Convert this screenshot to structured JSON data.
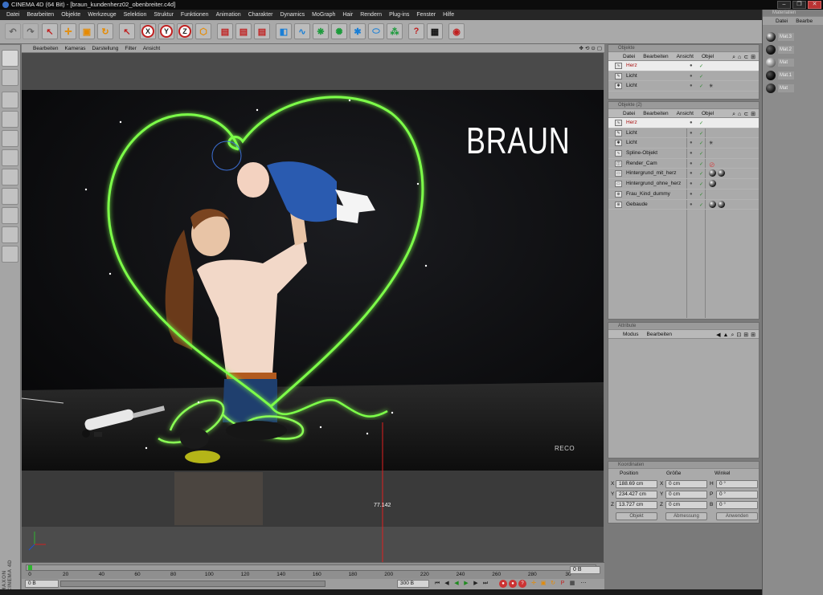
{
  "window": {
    "title": "CINEMA 4D (64 Bit) - [braun_kundenherz02_obenbreiter.c4d]"
  },
  "menubar": [
    "Datei",
    "Bearbeiten",
    "Objekte",
    "Werkzeuge",
    "Selektion",
    "Struktur",
    "Funktionen",
    "Animation",
    "Charakter",
    "Dynamics",
    "MoGraph",
    "Hair",
    "Rendern",
    "Plug-ins",
    "Fenster",
    "Hilfe"
  ],
  "viewport": {
    "menu": [
      "Bearbeiten",
      "Kameras",
      "Darstellung",
      "Filter",
      "Ansicht"
    ],
    "nav_icons": [
      "move-view-icon",
      "camera-view-icon",
      "rotate-view-icon",
      "maximize-view-icon"
    ],
    "ruler_value": "77.142",
    "logo_text": "BRAUN",
    "watermark": "RECO"
  },
  "objects_panel_1": {
    "header": "Objekte",
    "menu": [
      "Datei",
      "Bearbeiten",
      "Ansicht",
      "Objel"
    ],
    "rows": [
      {
        "name": "Herz",
        "selected": true
      },
      {
        "name": "Licht",
        "selected": false
      },
      {
        "name": "Licht",
        "selected": false
      }
    ]
  },
  "objects_panel_2": {
    "header": "Objekte (2)",
    "menu": [
      "Datei",
      "Bearbeiten",
      "Ansicht",
      "Objel"
    ],
    "rows": [
      {
        "name": "Herz",
        "selected": true
      },
      {
        "name": "Licht",
        "selected": false
      },
      {
        "name": "Licht",
        "selected": false
      },
      {
        "name": "Spline-Objekt",
        "selected": false
      },
      {
        "name": "Render_Cam",
        "selected": false
      },
      {
        "name": "Hintergrund_mit_herz",
        "selected": false
      },
      {
        "name": "Hintergrund_ohne_herz",
        "selected": false
      },
      {
        "name": "Frau_Kind_dummy",
        "selected": false
      },
      {
        "name": "Gebaude",
        "selected": false
      }
    ]
  },
  "attributes_panel": {
    "header": "Attribute",
    "menu": [
      "Modus",
      "Bearbeiten"
    ]
  },
  "coordinates_panel": {
    "header": "Koordinaten",
    "columns": [
      "Position",
      "Größe",
      "Winkel"
    ],
    "rows": [
      {
        "axis": "X",
        "pos": "188.69 cm",
        "size_axis": "X",
        "size": "0 cm",
        "rot_axis": "H",
        "rot": "0 °"
      },
      {
        "axis": "Y",
        "pos": "234.427 cm",
        "size_axis": "Y",
        "size": "0 cm",
        "rot_axis": "P",
        "rot": "0 °"
      },
      {
        "axis": "Z",
        "pos": "13.727 cm",
        "size_axis": "Z",
        "size": "0 cm",
        "rot_axis": "B",
        "rot": "0 °"
      }
    ],
    "mode_select": "Objekt",
    "size_select": "Abmessung",
    "apply_button": "Anwenden"
  },
  "materials_panel": {
    "header": "Materialien",
    "menu": [
      "Datei",
      "Bearbe"
    ],
    "items": [
      "Mat.3",
      "Mat.2",
      "Mat",
      "Mat.1",
      "Mat"
    ]
  },
  "timeline": {
    "ticks": [
      "0",
      "20",
      "40",
      "60",
      "80",
      "100",
      "120",
      "140",
      "160",
      "180",
      "200",
      "220",
      "240",
      "260",
      "280",
      "30"
    ],
    "frame_end": "0 B",
    "current_frame": "0 B",
    "end_frame": "300 B"
  },
  "colors": {
    "accent": "#f0a030",
    "selection": "#cc2222",
    "neon": "#7dff4a"
  }
}
